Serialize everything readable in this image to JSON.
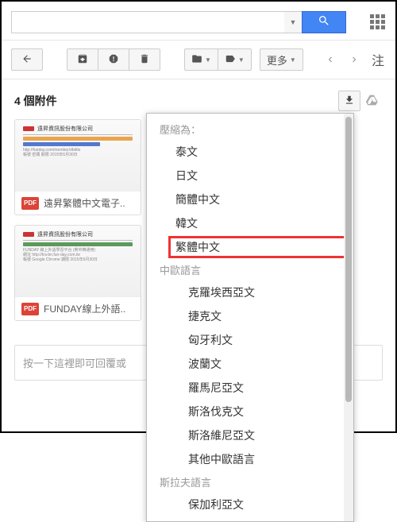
{
  "search": {
    "placeholder": ""
  },
  "toolbar": {
    "more_label": "更多"
  },
  "attachments": {
    "header": "4 個附件",
    "items": [
      {
        "name": "遠昇繁體中文電子..",
        "badge": "PDF"
      },
      {
        "name": "FUNDAY線上外語..",
        "badge": "PDF"
      }
    ]
  },
  "reply_placeholder": "按一下這裡即可回覆或",
  "dropdown": {
    "header": "壓縮為：",
    "items": [
      {
        "label": "泰文"
      },
      {
        "label": "日文"
      },
      {
        "label": "簡體中文"
      },
      {
        "label": "韓文"
      },
      {
        "label": "繁體中文",
        "selected": true
      },
      {
        "label": "中歐語言",
        "section": true
      },
      {
        "label": "克羅埃西亞文",
        "sub": true
      },
      {
        "label": "捷克文",
        "sub": true
      },
      {
        "label": "匈牙利文",
        "sub": true
      },
      {
        "label": "波蘭文",
        "sub": true
      },
      {
        "label": "羅馬尼亞文",
        "sub": true
      },
      {
        "label": "斯洛伐克文",
        "sub": true
      },
      {
        "label": "斯洛維尼亞文",
        "sub": true
      },
      {
        "label": "其他中歐語言",
        "sub": true
      },
      {
        "label": "斯拉夫語言",
        "section": true
      },
      {
        "label": "保加利亞文",
        "sub": true
      }
    ]
  }
}
